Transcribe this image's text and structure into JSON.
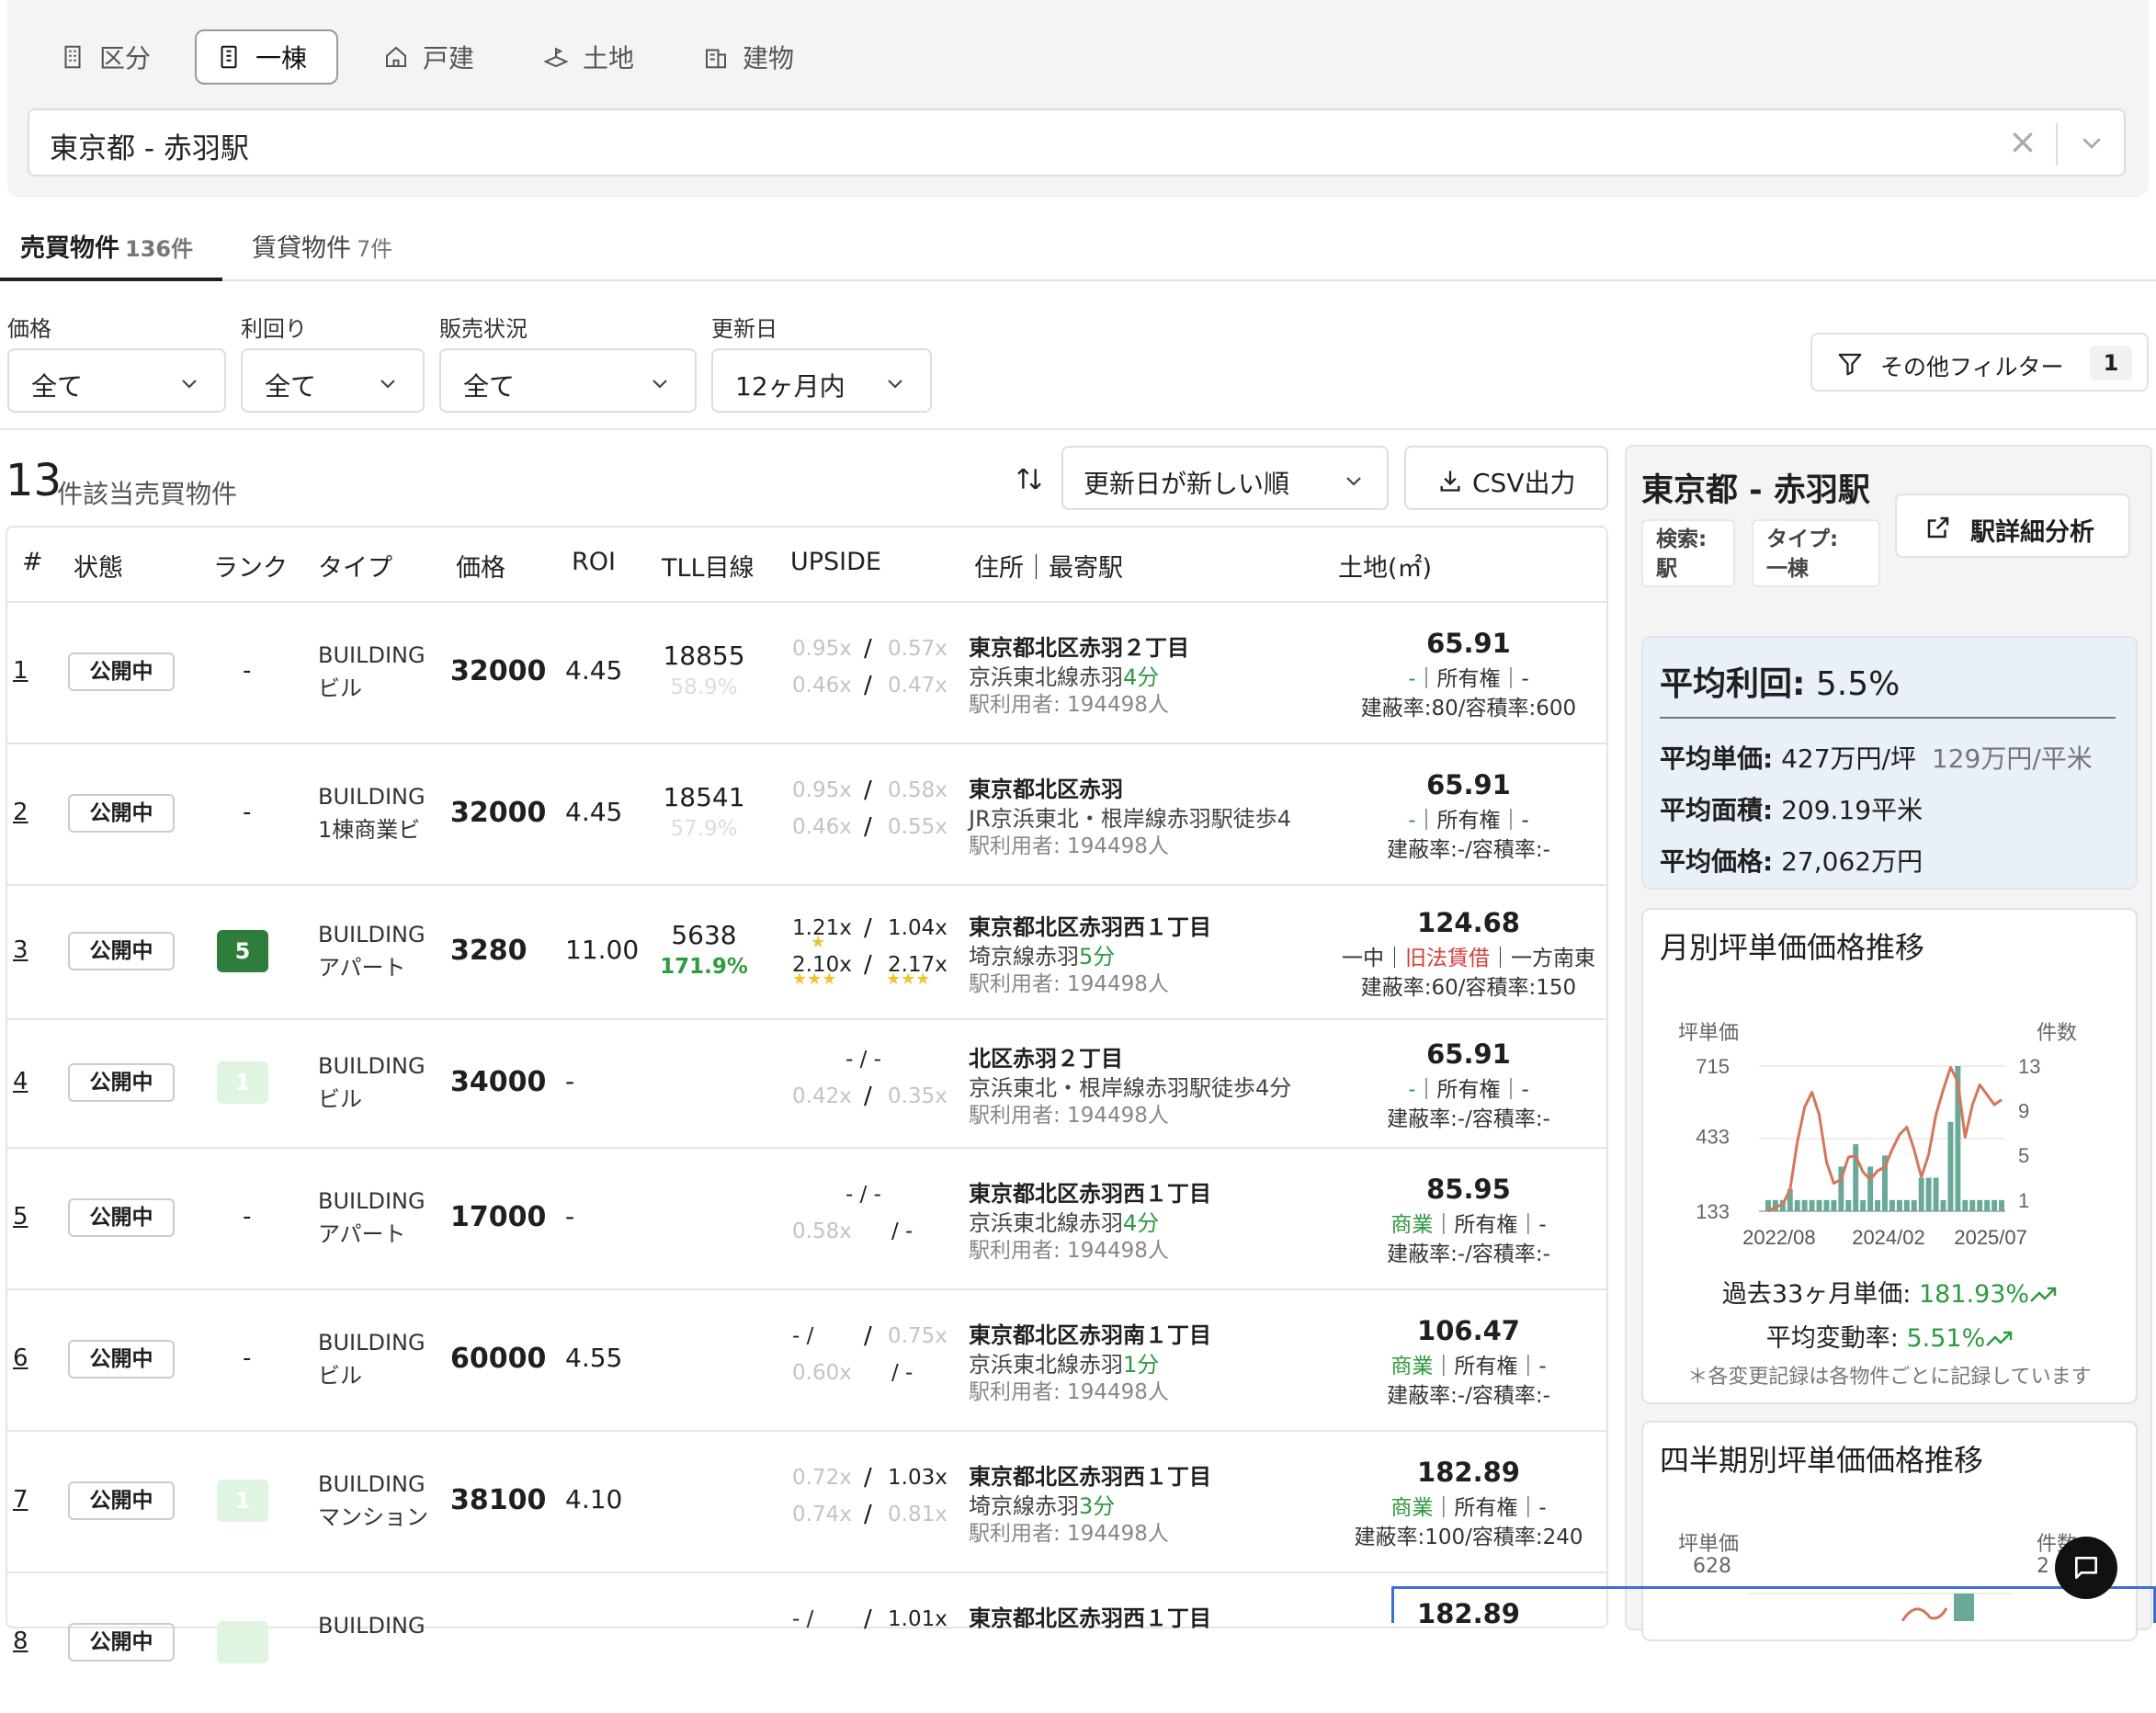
{
  "property_tabs": [
    {
      "label": "区分",
      "icon": "building-icon",
      "active": false
    },
    {
      "label": "一棟",
      "icon": "tower-icon",
      "active": true
    },
    {
      "label": "戸建",
      "icon": "house-icon",
      "active": false
    },
    {
      "label": "土地",
      "icon": "land-icon",
      "active": false
    },
    {
      "label": "建物",
      "icon": "office-icon",
      "active": false
    }
  ],
  "location": {
    "value": "東京都 - 赤羽駅",
    "clear": "×"
  },
  "main_tabs": [
    {
      "label": "売買物件",
      "count": "136件",
      "active": true
    },
    {
      "label": "賃貸物件",
      "count": "7件",
      "active": false
    }
  ],
  "filters": [
    {
      "label": "価格",
      "value": "全て"
    },
    {
      "label": "利回り",
      "value": "全て"
    },
    {
      "label": "販売状況",
      "value": "全て"
    },
    {
      "label": "更新日",
      "value": "12ヶ月内"
    }
  ],
  "more_filter": {
    "label": "その他フィルター",
    "badge": "1"
  },
  "results": {
    "count": "13",
    "text": "件該当売買物件"
  },
  "sort": {
    "value": "更新日が新しい順"
  },
  "csv": {
    "label": "CSV出力"
  },
  "columns": [
    "#",
    "状態",
    "ランク",
    "タイプ",
    "価格",
    "ROI",
    "TLL目線",
    "UPSIDE",
    "住所｜最寄駅",
    "土地(㎡)"
  ],
  "rows": [
    {
      "num": "1",
      "status": "公開中",
      "rank": "-",
      "rank_style": "none",
      "type1": "BUILDING",
      "type2": "ビル",
      "price": "32000",
      "roi": "4.45",
      "tll": "18855",
      "tll_pct": "58.9%",
      "tll_pct_style": "faint",
      "up_tl": "0.95x",
      "up_tr": "0.57x",
      "up_bl": "0.46x",
      "up_br": "0.47x",
      "up_tl_dim": true,
      "up_tr_dim": true,
      "up_bl_dim": true,
      "up_br_dim": true,
      "addr": "東京都北区赤羽２丁目",
      "line": "京浜東北線赤羽",
      "walk": "4分",
      "users": "駅利用者: 194498人",
      "area": "65.91",
      "zone": "-",
      "zone_style": "green",
      "own": "｜所有権｜-",
      "ratio": "建蔽率:80/容積率:600"
    },
    {
      "num": "2",
      "status": "公開中",
      "rank": "-",
      "rank_style": "none",
      "type1": "BUILDING",
      "type2": "1棟商業ビ",
      "price": "32000",
      "roi": "4.45",
      "tll": "18541",
      "tll_pct": "57.9%",
      "tll_pct_style": "faint",
      "up_tl": "0.95x",
      "up_tr": "0.58x",
      "up_bl": "0.46x",
      "up_br": "0.55x",
      "up_tl_dim": true,
      "up_tr_dim": true,
      "up_bl_dim": true,
      "up_br_dim": true,
      "addr": "東京都北区赤羽",
      "line": "JR京浜東北・根岸線赤羽駅徒歩4",
      "walk": "",
      "users": "駅利用者: 194498人",
      "area": "65.91",
      "zone": "-",
      "zone_style": "green",
      "own": "｜所有権｜-",
      "ratio": "建蔽率:-/容積率:-"
    },
    {
      "num": "3",
      "status": "公開中",
      "rank": "5",
      "rank_style": "dark",
      "type1": "BUILDING",
      "type2": "アパート",
      "price": "3280",
      "roi": "11.00",
      "tll": "5638",
      "tll_pct": "171.9%",
      "tll_pct_style": "green",
      "up_tl": "1.21x",
      "up_tr": "1.04x",
      "up_bl": "2.10x",
      "up_br": "2.17x",
      "up_tl_dim": false,
      "up_tr_dim": false,
      "up_bl_dim": false,
      "up_br_dim": false,
      "stars_tl": "★",
      "stars_bl": "★★★",
      "stars_br": "★★★",
      "addr": "東京都北区赤羽西１丁目",
      "line": "埼京線赤羽",
      "walk": "5分",
      "users": "駅利用者: 194498人",
      "area": "124.68",
      "zone": "一中｜",
      "zone2": "旧法賃借",
      "zone3": "｜一方南東",
      "ratio": "建蔽率:60/容積率:150"
    },
    {
      "num": "4",
      "status": "公開中",
      "rank": "1",
      "rank_style": "light",
      "type1": "BUILDING",
      "type2": "ビル",
      "price": "34000",
      "roi": "-",
      "tll": "",
      "tll_pct": "",
      "up_tl": "- / -",
      "up_tr": "",
      "up_bl": "0.42x",
      "up_br": "0.35x",
      "up_tl_dim": false,
      "up_bl_dim": true,
      "up_br_dim": true,
      "addr": "北区赤羽２丁目",
      "line": "京浜東北・根岸線赤羽駅徒歩4分",
      "walk": "",
      "users": "駅利用者: 194498人",
      "area": "65.91",
      "zone": "-",
      "zone_style": "green",
      "own": "｜所有権｜-",
      "ratio": "建蔽率:-/容積率:-"
    },
    {
      "num": "5",
      "status": "公開中",
      "rank": "-",
      "rank_style": "none",
      "type1": "BUILDING",
      "type2": "アパート",
      "price": "17000",
      "roi": "-",
      "tll": "",
      "tll_pct": "",
      "up_tl": "- / -",
      "up_bl": "0.58x",
      "up_br": "/ -",
      "up_tl_dim": false,
      "up_bl_dim": true,
      "up_br_dim": false,
      "addr": "東京都北区赤羽西１丁目",
      "line": "京浜東北線赤羽",
      "walk": "4分",
      "users": "駅利用者: 194498人",
      "area": "85.95",
      "zone": "商業",
      "zone_style": "green",
      "own": "｜所有権｜-",
      "ratio": "建蔽率:-/容積率:-"
    },
    {
      "num": "6",
      "status": "公開中",
      "rank": "-",
      "rank_style": "none",
      "type1": "BUILDING",
      "type2": "ビル",
      "price": "60000",
      "roi": "4.55",
      "tll": "",
      "tll_pct": "",
      "up_tl": "- /",
      "up_tr": "0.75x",
      "up_bl": "0.60x",
      "up_br": "/ -",
      "up_tl_dim": false,
      "up_tr_dim": true,
      "up_bl_dim": true,
      "up_br_dim": false,
      "addr": "東京都北区赤羽南１丁目",
      "line": "京浜東北線赤羽",
      "walk": "1分",
      "users": "駅利用者: 194498人",
      "area": "106.47",
      "zone": "商業",
      "zone_style": "green",
      "own": "｜所有権｜-",
      "ratio": "建蔽率:-/容積率:-"
    },
    {
      "num": "7",
      "status": "公開中",
      "rank": "1",
      "rank_style": "light",
      "type1": "BUILDING",
      "type2": "マンション",
      "price": "38100",
      "roi": "4.10",
      "tll": "",
      "tll_pct": "",
      "up_tl": "0.72x",
      "up_tr": "1.03x",
      "up_bl": "0.74x",
      "up_br": "0.81x",
      "up_tl_dim": true,
      "up_tr_dim": false,
      "up_bl_dim": true,
      "up_br_dim": true,
      "addr": "東京都北区赤羽西１丁目",
      "line": "埼京線赤羽",
      "walk": "3分",
      "users": "駅利用者: 194498人",
      "area": "182.89",
      "zone": "商業",
      "zone_style": "green",
      "own": "｜所有権｜-",
      "ratio": "建蔽率:100/容積率:240"
    },
    {
      "num": "8",
      "status": "公開中",
      "rank": "",
      "rank_style": "light",
      "type1": "BUILDING",
      "type2": "",
      "price": "",
      "roi": "",
      "tll": "",
      "tll_pct": "",
      "up_tl": "- /",
      "up_tr": "1.01x",
      "addr": "東京都北区赤羽西１丁目",
      "line": "",
      "walk": "",
      "users": "",
      "area": "182.89",
      "ratio": ""
    }
  ],
  "right_panel": {
    "title": "東京都 - 赤羽駅",
    "search_chip": {
      "l1": "検索:",
      "l2": "駅"
    },
    "type_chip": {
      "l1": "タイプ:",
      "l2": "一棟"
    },
    "detail_button": "駅詳細分析",
    "avg_roi_label": "平均利回:",
    "avg_roi_value": "5.5%",
    "avg_unit_label": "平均単価:",
    "avg_unit_value": "427万円/坪",
    "avg_unit_sqm": "129万円/平米",
    "avg_area_label": "平均面積:",
    "avg_area_value": "209.19平米",
    "avg_price_label": "平均価格:",
    "avg_price_value": "27,062万円",
    "monthly_title": "月別坪単価価格推移",
    "monthly_left_axis": "坪単価",
    "monthly_right_axis": "件数",
    "monthly_change_label": "過去33ヶ月単価:",
    "monthly_change_value": "181.93%",
    "avg_change_label": "平均変動率:",
    "avg_change_value": "5.51%",
    "note": "＊各変更記録は各物件ごとに記録しています",
    "quarterly_title": "四半期別坪単価価格推移",
    "quarterly_left_axis": "坪単価",
    "quarterly_left_top": "628",
    "quarterly_right_axis": "件数",
    "quarterly_right_top": "2"
  },
  "chart_data": {
    "type": "bar",
    "title": "月別坪単価価格推移",
    "x_ticks": [
      "2022/08",
      "2024/02",
      "2025/07"
    ],
    "y_left_ticks": [
      133,
      433,
      715
    ],
    "y_right_ticks": [
      1,
      5,
      9,
      13
    ],
    "ylim_left": [
      133,
      715
    ],
    "ylim_right": [
      1,
      13
    ],
    "series": [
      {
        "name": "件数",
        "type": "bar",
        "color": "#6aa999",
        "values": [
          1,
          1,
          1,
          2,
          1,
          1,
          1,
          1,
          1,
          1,
          4,
          1,
          6,
          1,
          4,
          1,
          5,
          1,
          1,
          1,
          1,
          3,
          3,
          3,
          1,
          8,
          13,
          1,
          1,
          1,
          1,
          1,
          1
        ]
      },
      {
        "name": "坪単価",
        "type": "line",
        "color": "#d4765a",
        "values": [
          133,
          150,
          160,
          220,
          410,
          550,
          610,
          520,
          330,
          245,
          260,
          350,
          355,
          290,
          260,
          295,
          310,
          380,
          440,
          470,
          380,
          270,
          360,
          520,
          620,
          710,
          650,
          430,
          560,
          640,
          600,
          560,
          580
        ]
      }
    ]
  },
  "chat_icon": "chat-icon"
}
